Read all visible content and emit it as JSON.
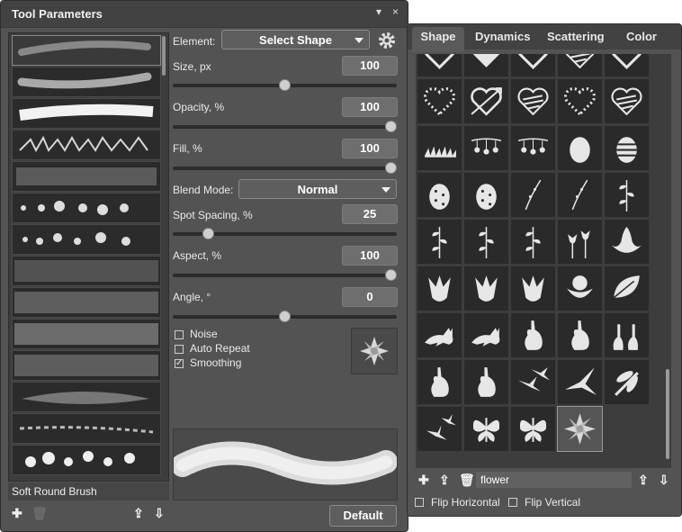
{
  "left_panel": {
    "title": "Tool Parameters",
    "menu_btn": "▾",
    "close_btn": "×",
    "element_label": "Element:",
    "element_value": "Select Shape",
    "brush_name": "Soft Round Brush",
    "params": [
      {
        "label": "Size, px",
        "value": "100",
        "level": 0.5
      },
      {
        "label": "Opacity, %",
        "value": "100",
        "level": 1.0
      },
      {
        "label": "Fill, %",
        "value": "100",
        "level": 1.0
      },
      {
        "label": "Spot Spacing, %",
        "value": "25",
        "level": 0.14
      },
      {
        "label": "Aspect, %",
        "value": "100",
        "level": 1.0
      },
      {
        "label": "Angle, °",
        "value": "0",
        "level": 0.5
      }
    ],
    "blend_label": "Blend Mode:",
    "blend_value": "Normal",
    "checkboxes": [
      {
        "label": "Noise",
        "checked": false
      },
      {
        "label": "Auto Repeat",
        "checked": false
      },
      {
        "label": "Smoothing",
        "checked": true
      }
    ],
    "default_button": "Default",
    "check_mark": "✓"
  },
  "right_panel": {
    "tabs": [
      "Shape",
      "Dynamics",
      "Scattering",
      "Color"
    ],
    "active_tab": "Shape",
    "search_value": "flower",
    "flip_horizontal": "Flip Horizontal",
    "flip_vertical": "Flip Vertical",
    "shapes": [
      "heart-outline",
      "heart",
      "heart-outline",
      "heart-scribble",
      "heart-outline",
      "heart-dotted",
      "heart-arrow",
      "heart-scribble",
      "heart-dotted",
      "heart-scribble",
      "grass",
      "berries-branch",
      "berries-branch",
      "egg",
      "egg-striped",
      "egg-dotted",
      "egg-dotted",
      "twig",
      "twig",
      "leaf-branch",
      "leaf-branch",
      "leaf-branch",
      "leaf-branch",
      "tulips",
      "lotus",
      "tulip",
      "tulip",
      "tulip",
      "tulip-open",
      "leaf",
      "rabbit-running",
      "rabbit-running",
      "rabbit",
      "rabbit",
      "rabbits",
      "rabbit",
      "rabbit",
      "swallows",
      "swallow",
      "dragonfly",
      "birds",
      "butterfly",
      "butterfly",
      "flower"
    ]
  }
}
